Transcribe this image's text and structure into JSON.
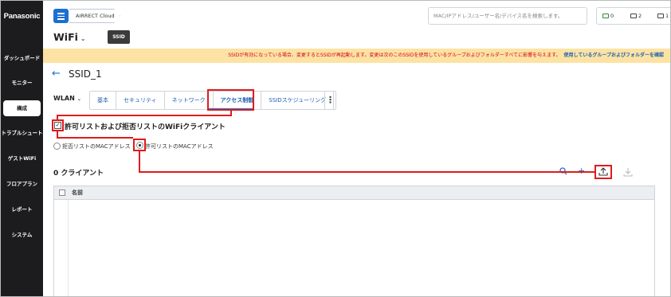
{
  "brand": "Panasonic",
  "sidebar": {
    "items": [
      {
        "label": "ダッシュボード"
      },
      {
        "label": "モニター"
      },
      {
        "label": "構成"
      },
      {
        "label": "トラブルシュート"
      },
      {
        "label": "ゲストWiFi"
      },
      {
        "label": "フロアプラン"
      },
      {
        "label": "レポート"
      },
      {
        "label": "システム"
      }
    ],
    "active_index": 2
  },
  "header": {
    "org_label": "AIRRECT Cloud",
    "search_placeholder": "MAC/IPアドレス/ユーザー名/デバイス名を検索します。",
    "stats": [
      {
        "icon": "laptop-icon",
        "value": "0"
      },
      {
        "icon": "switch-icon",
        "value": "2"
      },
      {
        "icon": "ap-icon",
        "value": "1"
      }
    ]
  },
  "page": {
    "title": "WiFi",
    "title_chevron": "⌄",
    "tooltip": "SSID"
  },
  "banner": {
    "warning": "SSIDが有効になっている場合、変更するとSSIDが再起動します。変更は次のこのSSIDを使用しているグループおよびフォルダーすべてに影響を与えます。",
    "link": "使用しているグループおよびフォルダーを確認"
  },
  "ssid": {
    "back_icon": "arrow-left-icon",
    "name": "SSID_1"
  },
  "wlan": {
    "label": "WLAN",
    "chevron": "⌄"
  },
  "tabs": [
    {
      "label": "基本"
    },
    {
      "label": "セキュリティ"
    },
    {
      "label": "ネットワーク"
    },
    {
      "label": "アクセス制御"
    },
    {
      "label": "SSIDスケジューリング"
    }
  ],
  "active_tab_index": 3,
  "kebab": "⋮",
  "access_control": {
    "checkbox_checked": true,
    "checkbox_mark": "✓",
    "checkbox_label": "許可リストおよび拒否リストのWiFiクライアント",
    "options": [
      {
        "label": "拒否リストのMACアドレス",
        "selected": false
      },
      {
        "label": "許可リストのMACアドレス",
        "selected": true
      }
    ]
  },
  "clients": {
    "title": "0 クライアント",
    "search_icon": "search-icon",
    "search_glyph": "🔍",
    "add_glyph": "+",
    "table_header": "名前"
  },
  "colors": {
    "sidebar_bg": "#1c1c1e",
    "accent": "#1d6fd1",
    "banner_bg": "#fde3a3",
    "warning_text": "#d0021b",
    "highlight": "#e01b1b"
  }
}
